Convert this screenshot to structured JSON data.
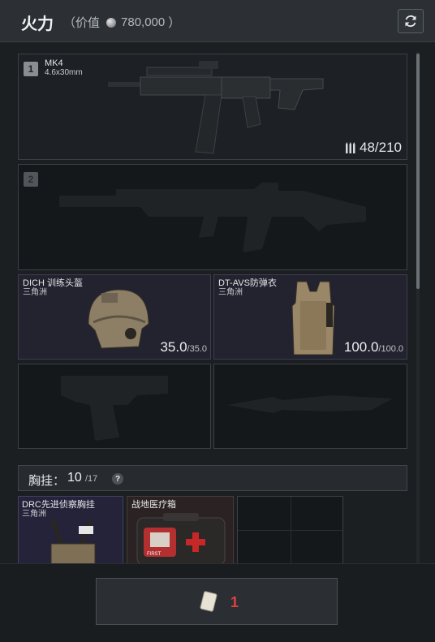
{
  "header": {
    "title": "火力",
    "value_label": "（价值",
    "value": "780,000",
    "value_close": "）"
  },
  "slots": {
    "primary1": {
      "number": "1",
      "name": "MK4",
      "caliber": "4.6x30mm",
      "ammo": "48/210"
    },
    "primary2": {
      "number": "2"
    },
    "helmet": {
      "name": "DICH 训练头盔",
      "brand": "三角洲",
      "durability": "35.0",
      "max": "/35.0"
    },
    "armor": {
      "name": "DT-AVS防弹衣",
      "brand": "三角洲",
      "durability": "100.0",
      "max": "/100.0"
    }
  },
  "chest_rig": {
    "label": "胸挂：",
    "count": "10",
    "capacity": "/17",
    "help": "?",
    "items": [
      {
        "name": "DRC先进侦察胸挂",
        "brand": "三角洲"
      },
      {
        "name": "战地医疗箱",
        "tag": "FIRST"
      }
    ]
  },
  "bottom": {
    "count": "1"
  },
  "colors": {
    "accent_red": "#e04040",
    "purple_slot": "#23222f"
  },
  "icons": [
    "refresh-icon",
    "coin-icon",
    "bullets-icon",
    "rifle-silhouette-icon",
    "pistol-silhouette-icon",
    "knife-silhouette-icon",
    "help-icon"
  ]
}
